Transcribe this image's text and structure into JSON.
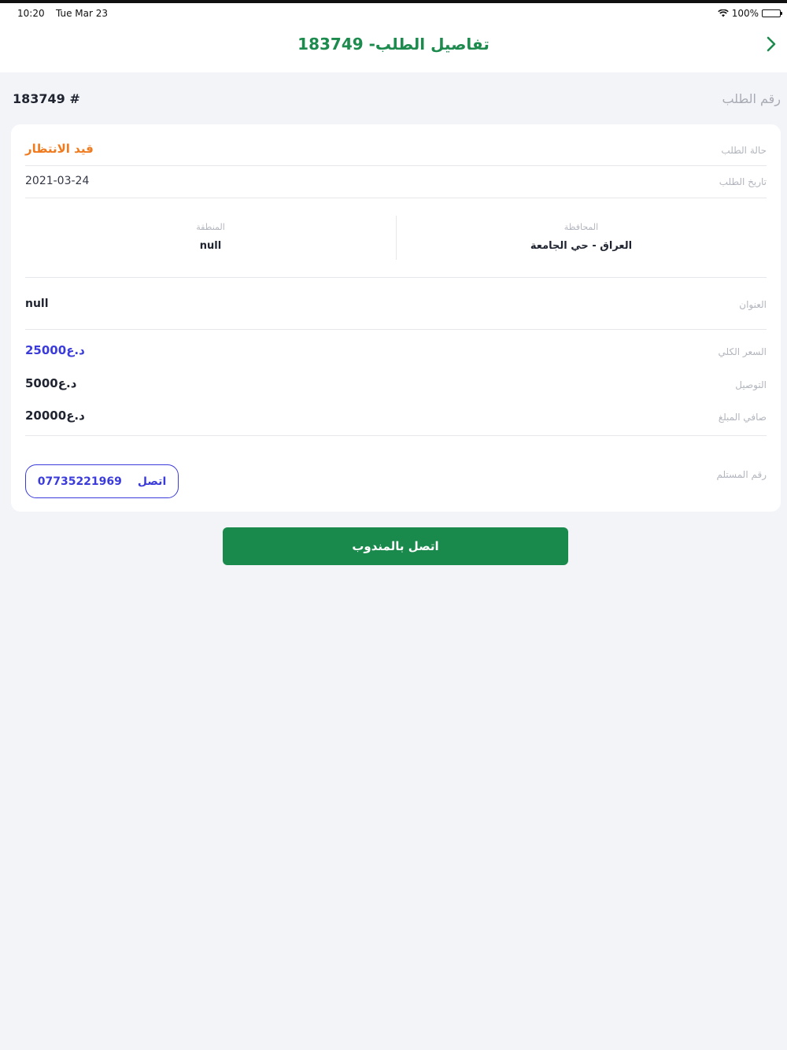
{
  "status_bar": {
    "time": "10:20",
    "date": "Tue Mar 23",
    "battery": "100%"
  },
  "nav": {
    "title": "تفاصيل الطلب- 183749",
    "back_icon": "chevron-right-icon"
  },
  "order": {
    "number_label": "رقم الطلب",
    "number_value": "183749 #"
  },
  "details": {
    "status_label": "حالة الطلب",
    "status_value": "قيد الانتظار",
    "date_label": "تاريخ الطلب",
    "date_value": "2021-03-24",
    "governorate_label": "المحافظة",
    "governorate_value": "العراق - حي الجامعة",
    "region_label": "المنطقة",
    "region_value": "null",
    "address_label": "العنوان",
    "address_value": "null",
    "total_label": "السعر الكلي",
    "total_value": "25000د.ع",
    "delivery_label": "التوصيل",
    "delivery_value": "5000د.ع",
    "net_label": "صافي المبلغ",
    "net_value": "20000د.ع",
    "recipient_label": "رقم المستلم",
    "call_label": "اتصل",
    "recipient_phone": "07735221969"
  },
  "actions": {
    "call_driver": "اتصل بالمندوب"
  },
  "colors": {
    "brand_green": "#1a8a4c",
    "status_orange": "#f07a1e",
    "link_blue": "#3b3bdb"
  }
}
